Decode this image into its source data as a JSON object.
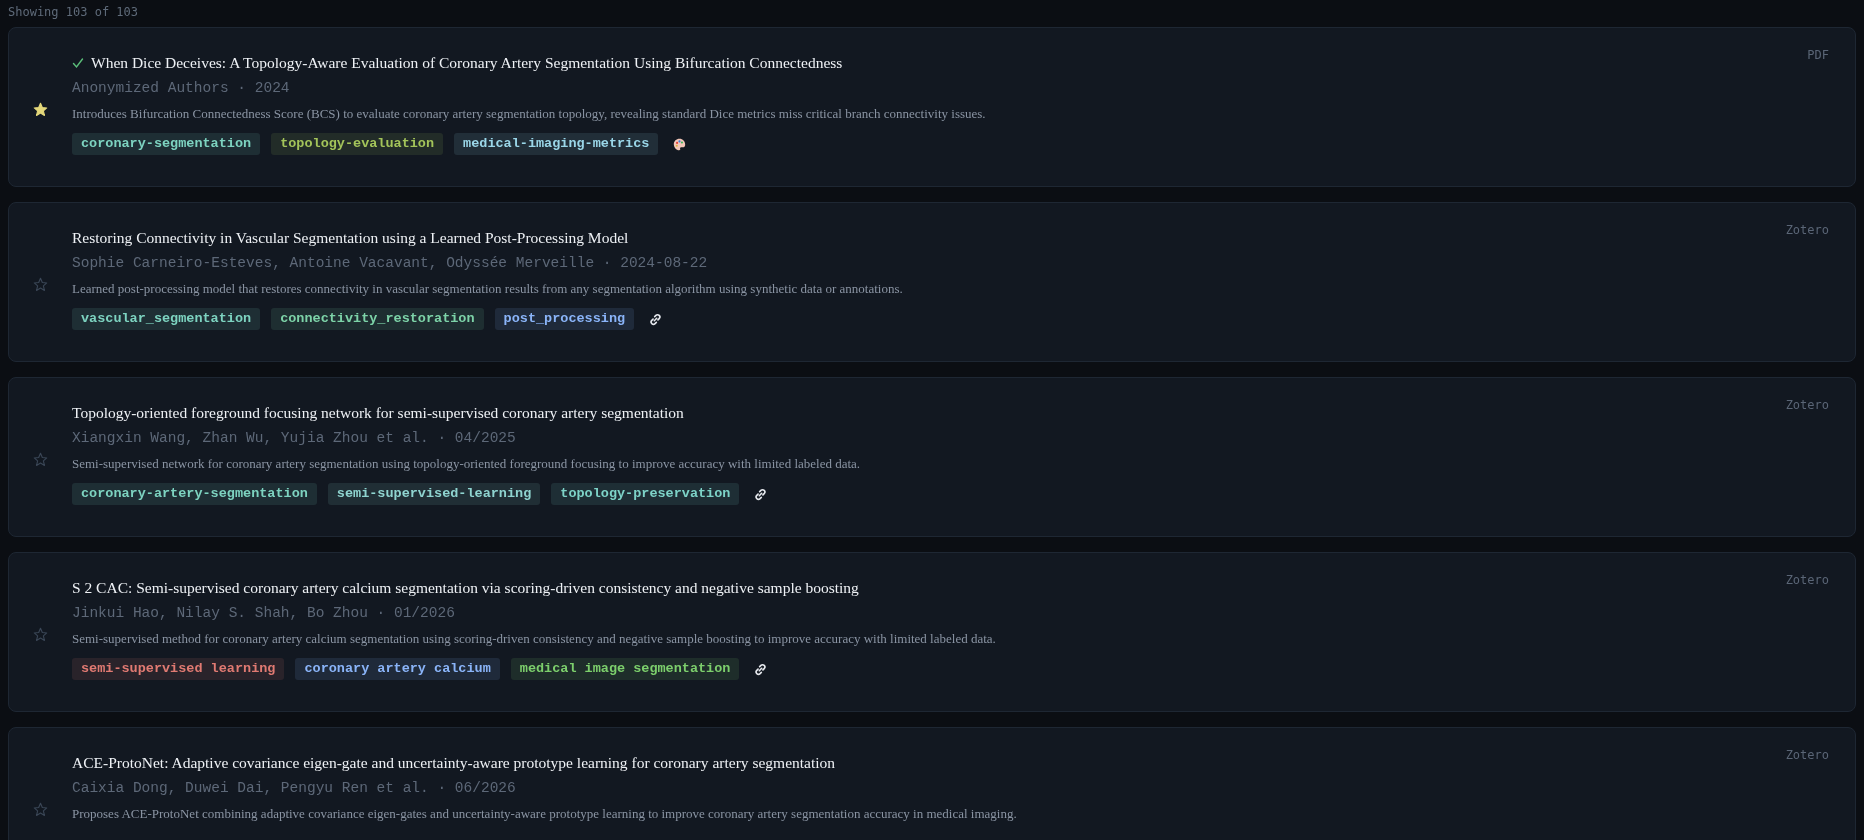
{
  "count_label": "Showing 103 of 103",
  "papers": [
    {
      "title": "When Dice Deceives: A Topology-Aware Evaluation of Coronary Artery Segmentation Using Bifurcation Connectedness",
      "read": true,
      "starred": true,
      "authors": "Anonymized Authors · 2024",
      "summary": "Introduces Bifurcation Connectedness Score (BCS) to evaluate coronary artery segmentation topology, revealing standard Dice metrics miss critical branch connectivity issues.",
      "tags": [
        {
          "label": "coronary-segmentation",
          "color": "#7dd3c0"
        },
        {
          "label": "topology-evaluation",
          "color": "#a3c45a"
        },
        {
          "label": "medical-imaging-metrics",
          "color": "#9ad6e8"
        }
      ],
      "attachment": {
        "kind": "palette"
      },
      "source": "PDF"
    },
    {
      "title": "Restoring Connectivity in Vascular Segmentation using a Learned Post-Processing Model",
      "read": false,
      "starred": false,
      "authors": "Sophie Carneiro-Esteves, Antoine Vacavant, Odyssée Merveille · 2024-08-22",
      "summary": "Learned post-processing model that restores connectivity in vascular segmentation results from any segmentation algorithm using synthetic data or annotations.",
      "tags": [
        {
          "label": "vascular_segmentation",
          "color": "#7dd3c0"
        },
        {
          "label": "connectivity_restoration",
          "color": "#7dd3a8"
        },
        {
          "label": "post_processing",
          "color": "#8ab4f8"
        }
      ],
      "attachment": {
        "kind": "link"
      },
      "source": "Zotero"
    },
    {
      "title": "Topology-oriented foreground focusing network for semi-supervised coronary artery segmentation",
      "read": false,
      "starred": false,
      "authors": "Xiangxin Wang, Zhan Wu, Yujia Zhou et al. · 04/2025",
      "summary": "Semi-supervised network for coronary artery segmentation using topology-oriented foreground focusing to improve accuracy with limited labeled data.",
      "tags": [
        {
          "label": "coronary-artery-segmentation",
          "color": "#7dd3c0"
        },
        {
          "label": "semi-supervised-learning",
          "color": "#8fd4d0"
        },
        {
          "label": "topology-preservation",
          "color": "#7dd3c8"
        }
      ],
      "attachment": {
        "kind": "link"
      },
      "source": "Zotero"
    },
    {
      "title": "S 2 CAC: Semi-supervised coronary artery calcium segmentation via scoring-driven consistency and negative sample boosting",
      "read": false,
      "starred": false,
      "authors": "Jinkui Hao, Nilay S. Shah, Bo Zhou · 01/2026",
      "summary": "Semi-supervised method for coronary artery calcium segmentation using scoring-driven consistency and negative sample boosting to improve accuracy with limited labeled data.",
      "tags": [
        {
          "label": "semi-supervised learning",
          "color": "#e07a72"
        },
        {
          "label": "coronary artery calcium",
          "color": "#8ab4f8"
        },
        {
          "label": "medical image segmentation",
          "color": "#7ccf6c"
        }
      ],
      "attachment": {
        "kind": "link"
      },
      "source": "Zotero"
    },
    {
      "title": "ACE-ProtoNet: Adaptive covariance eigen-gate and uncertainty-aware prototype learning for coronary artery segmentation",
      "read": false,
      "starred": false,
      "authors": "Caixia Dong, Duwei Dai, Pengyu Ren et al. · 06/2026",
      "summary": "Proposes ACE-ProtoNet combining adaptive covariance eigen-gates and uncertainty-aware prototype learning to improve coronary artery segmentation accuracy in medical imaging.",
      "source": "Zotero"
    }
  ]
}
